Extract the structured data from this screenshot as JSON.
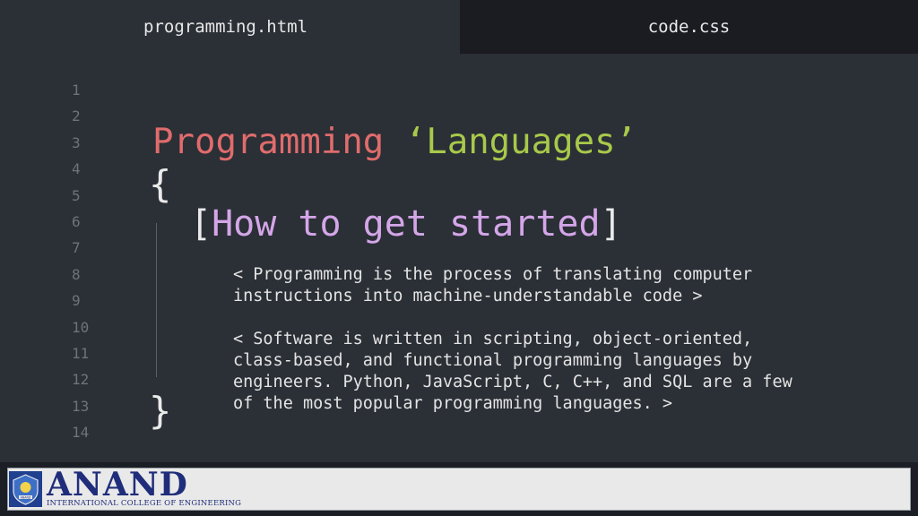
{
  "tabs": {
    "active": "programming.html",
    "inactive": "code.css"
  },
  "gutter": {
    "lines": [
      "1",
      "2",
      "3",
      "4",
      "5",
      "6",
      "7",
      "8",
      "9",
      "10",
      "11",
      "12",
      "13",
      "14"
    ]
  },
  "heading": {
    "keyword": "Programming",
    "string": "‘Languages’"
  },
  "braces": {
    "open": "{",
    "close": "}"
  },
  "subheading": {
    "bracket_open": "[",
    "text": "How to get started",
    "bracket_close": "]"
  },
  "paragraphs": {
    "first": "< Programming is the process of translating computer\ninstructions into machine-understandable code >",
    "second": "< Software is written in scripting, object-oriented,\nclass-based, and functional programming languages by\nengineers. Python, JavaScript, C, C++, and SQL are a few\nof the most popular programming languages. >"
  },
  "footer": {
    "name": "ANAND",
    "subtitle": "INTERNATIONAL COLLEGE OF ENGINEERING",
    "emblem_caption": "ANAND"
  },
  "colors": {
    "background": "#2b2f36",
    "keyword": "#e06c6c",
    "string": "#a8c94a",
    "subheading": "#d4a6e8",
    "brand": "#1f2d7a"
  }
}
